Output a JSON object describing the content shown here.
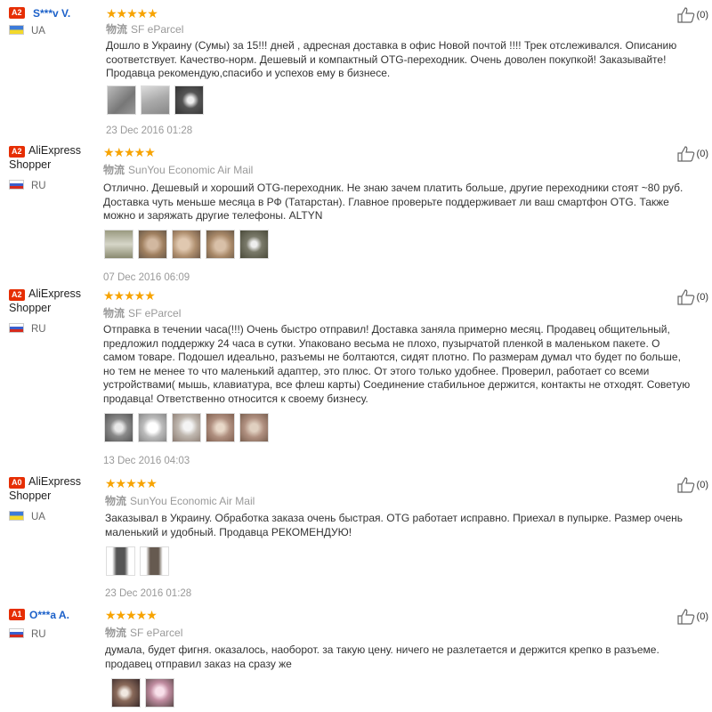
{
  "reviews": [
    {
      "badge": "A2",
      "user": "S***v V.",
      "country": "UA",
      "stars": "★★★★★",
      "shipping_label": "物流",
      "shipping": "SF eParcel",
      "text": "Дошло в Украину (Сумы) за 15!!! дней , адресная доставка в офис Новой почтой !!!! Трек отслеживался. Описанию соответствует. Качество-норм. Дешевый и компактный OTG-переходник. Очень доволен покупкой! Заказывайте! Продавца рекомендую,спасибо и успехов ему в бизнесе.",
      "date": "23 Dec 2016 01:28",
      "helpful": "(0)"
    },
    {
      "badge": "A2",
      "user": "AliExpress Shopper",
      "country": "RU",
      "stars": "★★★★★",
      "shipping_label": "物流",
      "shipping": "SunYou Economic Air Mail",
      "text": "Отлично. Дешевый и хороший OTG-переходник. Не знаю зачем платить больше, другие переходники стоят ~80 руб. Доставка чуть меньше месяца в РФ (Татарстан). Главное проверьте поддерживает ли ваш смартфон OTG. Также можно и заряжать другие телефоны. ALTYN",
      "date": "07 Dec 2016 06:09",
      "helpful": "(0)"
    },
    {
      "badge": "A2",
      "user": "AliExpress Shopper",
      "country": "RU",
      "stars": "★★★★★",
      "shipping_label": "物流",
      "shipping": "SF eParcel",
      "text": "Отправка в течении часа(!!!) Очень быстро отправил! Доставка заняла примерно месяц. Продавец общительный, предложил поддержку 24 часа в сутки. Упаковано весьма не плохо, пузырчатой пленкой в маленьком пакете. О самом товаре. Подошел идеально, разъемы не болтаются, сидят плотно. По размерам думал что будет по больше, но тем не менее то что маленький адаптер, это плюс. От этого только удобнее. Проверил, работает со всеми устройствами( мышь, клавиатура, все флеш карты) Соединение стабильное держится, контакты не отходят. Советую продавца! Ответственно относится к своему бизнесу.",
      "date": "13 Dec 2016 04:03",
      "helpful": "(0)"
    },
    {
      "badge": "A0",
      "user": "AliExpress Shopper",
      "country": "UA",
      "stars": "★★★★★",
      "shipping_label": "物流",
      "shipping": "SunYou Economic Air Mail",
      "text": "Заказывал в Украину. Обработка заказа очень быстрая. OTG работает исправно. Приехал в пупырке. Размер очень маленький и удобный. Продавца РЕКОМЕНДУЮ!",
      "date": "23 Dec 2016 01:28",
      "helpful": "(0)"
    },
    {
      "badge": "A1",
      "user": "O***a A.",
      "country": "RU",
      "stars": "★★★★★",
      "shipping_label": "物流",
      "shipping": "SF eParcel",
      "text": "думала, будет фигня. оказалось, наоборот. за такую цену. ничего не разлетается и держится крепко в разъеме. продавец отправил заказ на сразу же",
      "date": "",
      "helpful": "(0)"
    }
  ]
}
